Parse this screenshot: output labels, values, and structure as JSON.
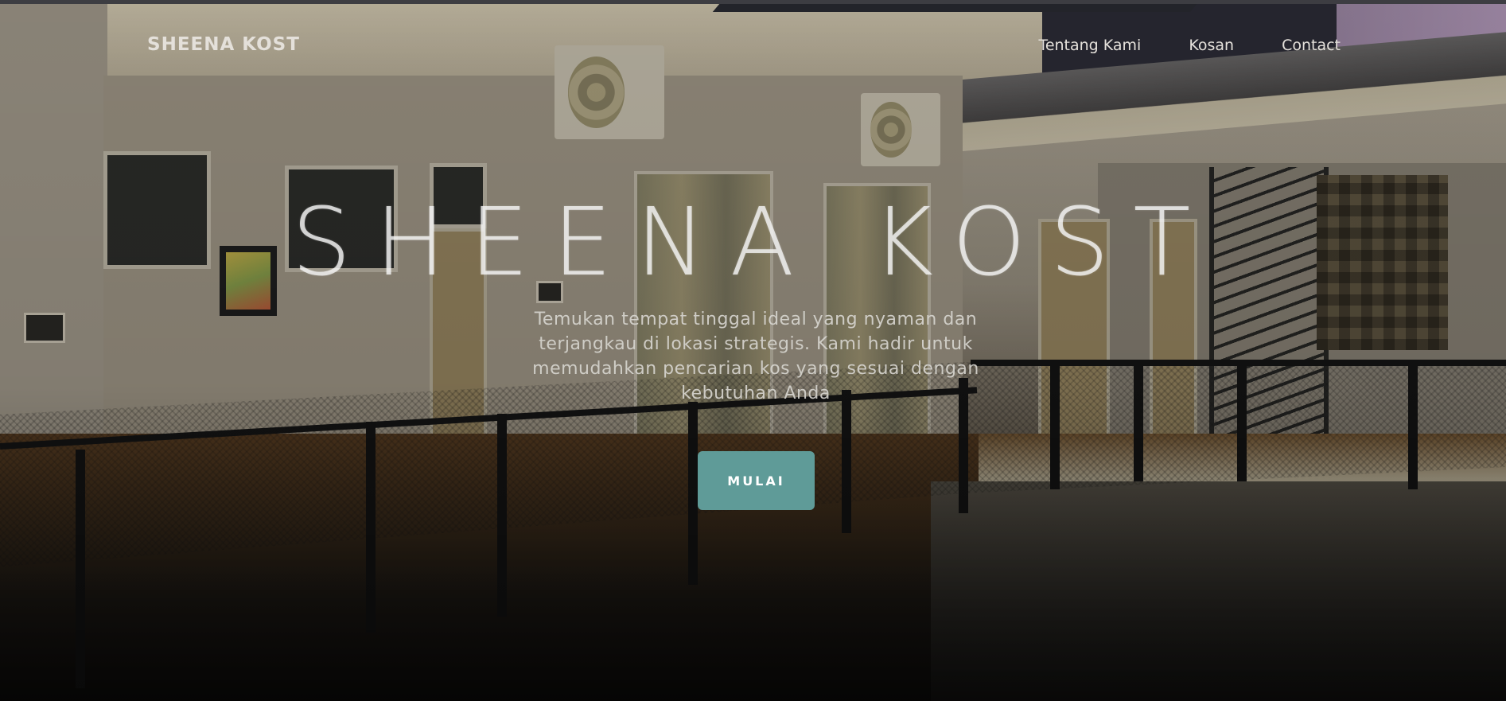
{
  "brand": {
    "name": "SHEENA KOST"
  },
  "nav": {
    "items": [
      {
        "label": "Tentang Kami"
      },
      {
        "label": "Kosan"
      },
      {
        "label": "Contact"
      }
    ]
  },
  "hero": {
    "title": "SHEENA KOST",
    "subtitle": "Temukan tempat tinggal ideal yang nyaman dan terjangkau di lokasi strategis. Kami hadir untuk memudahkan pencarian kos yang sesuai dengan kebutuhan Anda",
    "cta_label": "MULAI"
  },
  "colors": {
    "cta_background": "#5f9b98",
    "cta_text": "#ffffff",
    "nav_text": "#e6e2dc"
  }
}
